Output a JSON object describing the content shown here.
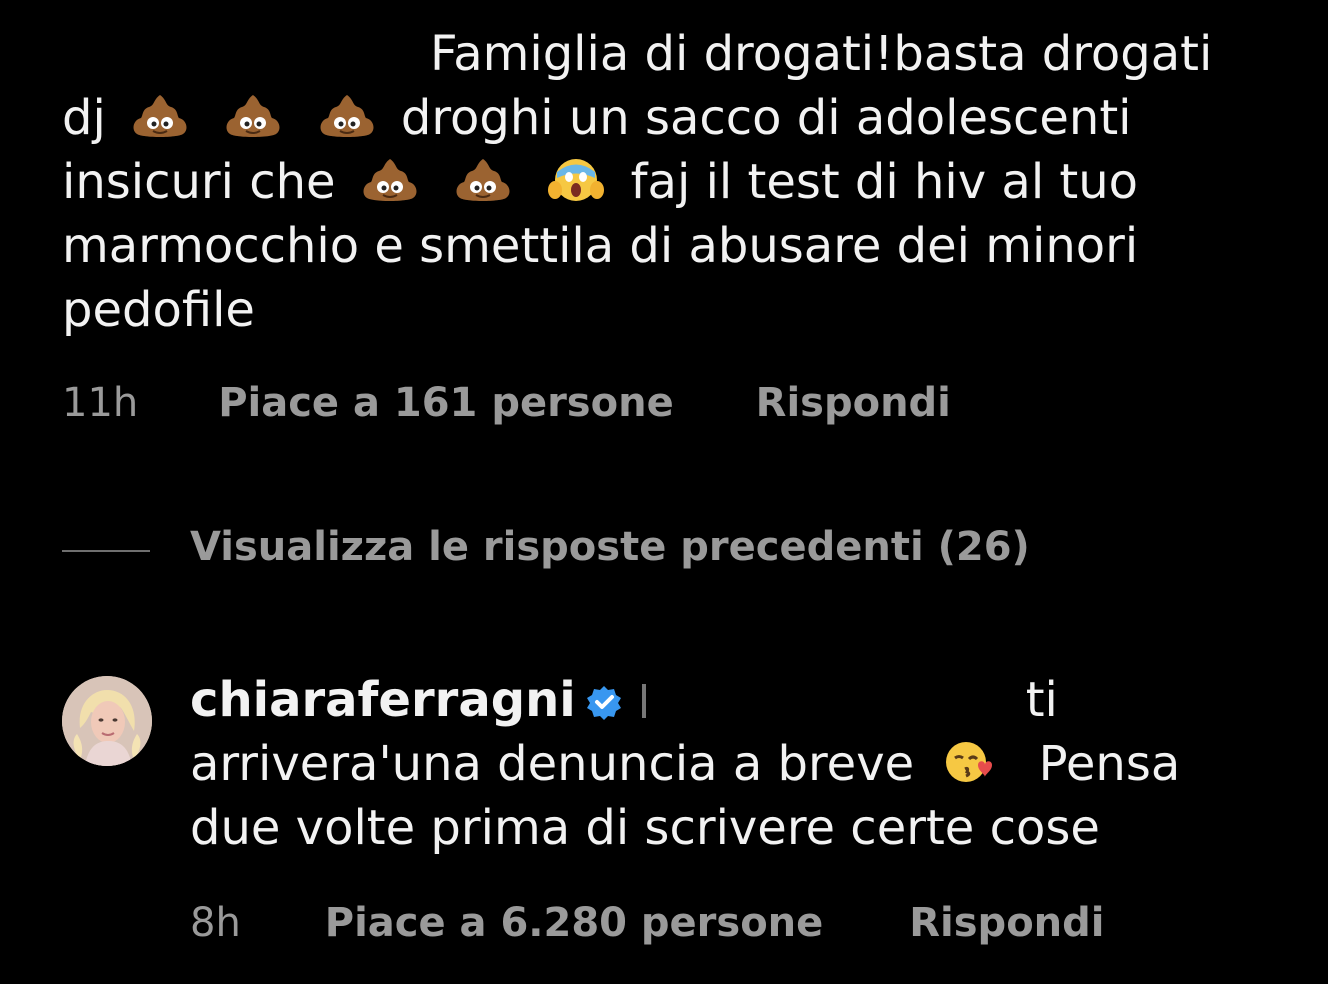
{
  "comment": {
    "line1": "Famiglia di drogati!basta drogati",
    "line2_prefix": "dj",
    "line2_suffix": "droghi un sacco di adolescenti",
    "line3_prefix": "insicuri che",
    "line3_suffix": "faj il test di hiv al tuo",
    "line4": "marmocchio e smettila di abusare dei minori",
    "line5": "pedofile",
    "time": "11h",
    "likes": "Piace a 161 persone",
    "reply_label": "Rispondi",
    "emojis": [
      "poop-emoji",
      "poop-emoji",
      "poop-emoji",
      "poop-emoji",
      "poop-emoji",
      "screaming-face-emoji"
    ]
  },
  "view_replies": {
    "label": "Visualizza le risposte precedenti (26)"
  },
  "reply": {
    "username": "chiaraferragni",
    "verified_icon": "verified-badge-icon",
    "line1_suffix": "ti",
    "line2_prefix": "arrivera'una denuncia a breve",
    "line2_suffix": "Pensa",
    "line3": "due volte prima di scrivere certe cose",
    "time": "8h",
    "likes": "Piace a 6.280 persone",
    "reply_label": "Rispondi",
    "emoji": "kissing-face-emoji"
  },
  "colors": {
    "background": "#000000",
    "text": "#f2f2f2",
    "meta": "#9a9a9a",
    "verified": "#3897f0"
  }
}
